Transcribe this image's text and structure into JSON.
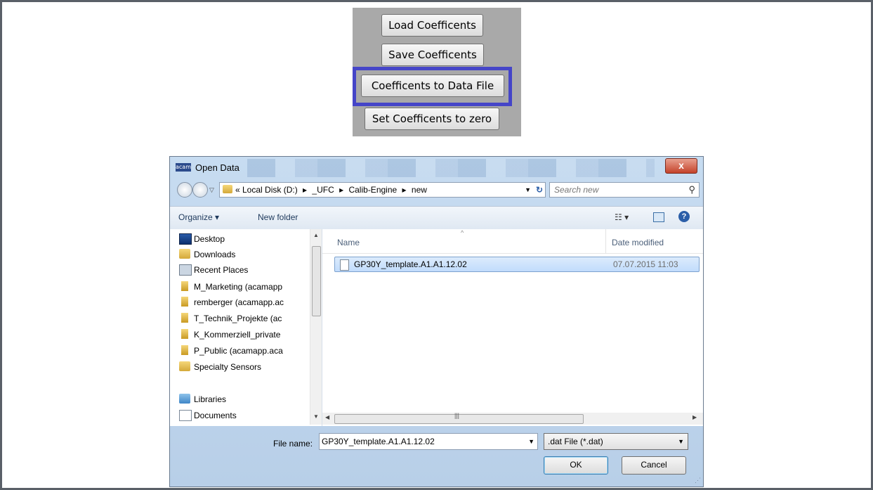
{
  "coef_panel": {
    "buttons": [
      "Load Coefficents",
      "Save Coefficents",
      "Coefficents to Data File",
      "Set Coefficents to zero"
    ]
  },
  "dialog": {
    "app_badge": "acam",
    "title": "Open Data",
    "close_label": "x",
    "address": {
      "breadcrumbs": [
        "« Local Disk (D:)",
        "▸",
        "_UFC",
        "▸",
        "Calib-Engine",
        "▸",
        "new"
      ],
      "search_placeholder": "Search new"
    },
    "toolbar": {
      "organize": "Organize ▾",
      "new_folder": "New folder",
      "help": "?"
    },
    "nav": {
      "items": [
        {
          "label": "Desktop",
          "icon": "desktop-icon"
        },
        {
          "label": "Downloads",
          "icon": "downloads-folder-icon"
        },
        {
          "label": "Recent Places",
          "icon": "recent-places-icon"
        },
        {
          "label": "M_Marketing (acamapp",
          "icon": "network-drive-icon"
        },
        {
          "label": "remberger (acamapp.ac",
          "icon": "network-drive-icon"
        },
        {
          "label": "T_Technik_Projekte (ac",
          "icon": "network-drive-icon"
        },
        {
          "label": "K_Kommerziell_private",
          "icon": "network-drive-icon"
        },
        {
          "label": "P_Public (acamapp.aca",
          "icon": "network-drive-icon"
        },
        {
          "label": "Specialty Sensors",
          "icon": "folder-icon"
        },
        {
          "label": "Libraries",
          "icon": "libraries-icon"
        },
        {
          "label": "Documents",
          "icon": "documents-icon"
        }
      ]
    },
    "files": {
      "columns": {
        "name": "Name",
        "date": "Date modified"
      },
      "rows": [
        {
          "name": "GP30Y_template.A1.A1.12.02",
          "date": "07.07.2015 11:03"
        }
      ]
    },
    "footer": {
      "file_name_label": "File name:",
      "file_name_value": "GP30Y_template.A1.A1.12.02",
      "file_type": ".dat File (*.dat)",
      "ok": "OK",
      "cancel": "Cancel"
    }
  },
  "colors": {
    "highlight": "#4545c8",
    "panel_bg": "#a9a9a9",
    "selection": "#c1dcfc"
  }
}
